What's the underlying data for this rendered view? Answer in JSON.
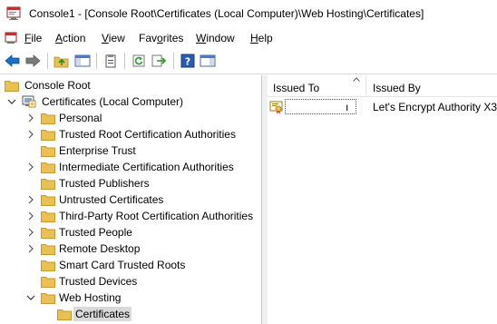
{
  "window": {
    "title": "Console1 - [Console Root\\Certificates (Local Computer)\\Web Hosting\\Certificates]"
  },
  "menu": {
    "items": [
      {
        "label_rest": "ile",
        "accel": "F"
      },
      {
        "label_rest": "ction",
        "accel": "A"
      },
      {
        "label_rest": "iew",
        "accel": "V"
      },
      {
        "label_pre": "Fav",
        "accel": "o",
        "label_rest": "rites"
      },
      {
        "label_rest": "indow",
        "accel": "W"
      },
      {
        "label_rest": "elp",
        "accel": "H"
      }
    ]
  },
  "toolbar": {
    "icons": [
      "back-arrow-icon",
      "forward-arrow-icon",
      "up-folder-icon",
      "show-hide-tree-icon",
      "properties-icon",
      "refresh-icon",
      "export-list-icon",
      "help-icon",
      "show-hide-action-pane-icon"
    ]
  },
  "tree": {
    "root": "Console Root",
    "store": "Certificates (Local Computer)",
    "folders": [
      {
        "label": "Personal",
        "expandable": true
      },
      {
        "label": "Trusted Root Certification Authorities",
        "expandable": true
      },
      {
        "label": "Enterprise Trust",
        "expandable": false
      },
      {
        "label": "Intermediate Certification Authorities",
        "expandable": true
      },
      {
        "label": "Trusted Publishers",
        "expandable": false
      },
      {
        "label": "Untrusted Certificates",
        "expandable": true
      },
      {
        "label": "Third-Party Root Certification Authorities",
        "expandable": true
      },
      {
        "label": "Trusted People",
        "expandable": true
      },
      {
        "label": "Remote Desktop",
        "expandable": true
      },
      {
        "label": "Smart Card Trusted Roots",
        "expandable": false
      },
      {
        "label": "Trusted Devices",
        "expandable": false
      },
      {
        "label": "Web Hosting",
        "expandable": true,
        "expanded": true
      }
    ],
    "selected_child": "Certificates"
  },
  "list": {
    "columns": [
      "Issued To",
      "Issued By"
    ],
    "rows": [
      {
        "issued_to": "ı",
        "issued_by": "Let's Encrypt Authority X3"
      }
    ]
  },
  "colors": {
    "folder": "#e8c054",
    "folder_dark": "#c89a2c",
    "selection": "#d9d9d9",
    "arrow_blue": "#1e6fc0"
  }
}
